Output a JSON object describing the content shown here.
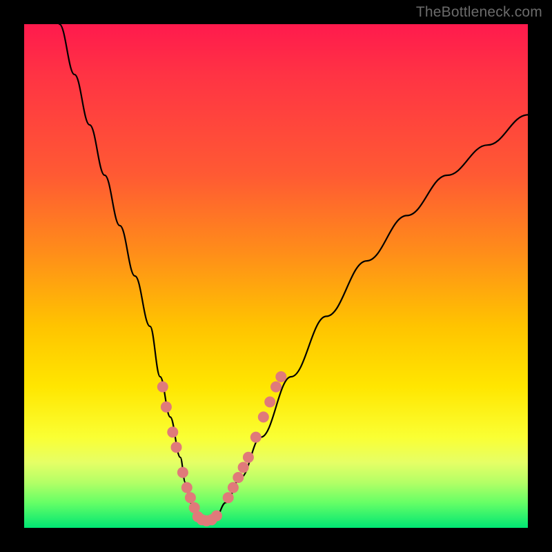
{
  "watermark": "TheBottleneck.com",
  "chart_data": {
    "type": "line",
    "title": "",
    "xlabel": "",
    "ylabel": "",
    "xlim": [
      0,
      100
    ],
    "ylim": [
      0,
      100
    ],
    "curve": {
      "note": "V-shaped bottleneck curve; left branch steep, right branch shallower. Points approximate reading from gradient background where 0=bottom(green) .. 100=top(red).",
      "x": [
        7,
        10,
        13,
        16,
        19,
        22,
        25,
        27,
        29,
        31,
        32,
        33,
        34,
        35,
        36,
        38,
        40,
        43,
        47,
        53,
        60,
        68,
        76,
        84,
        92,
        100
      ],
      "y": [
        100,
        90,
        80,
        70,
        60,
        50,
        40,
        30,
        22,
        14,
        9,
        5,
        3,
        1,
        1,
        2,
        5,
        10,
        18,
        30,
        42,
        53,
        62,
        70,
        76,
        82
      ]
    },
    "markers": {
      "note": "salmon-colored marker dots clustered near the valley on both branches",
      "left_branch": [
        {
          "x": 27.5,
          "y": 28
        },
        {
          "x": 28.2,
          "y": 24
        },
        {
          "x": 29.5,
          "y": 19
        },
        {
          "x": 30.2,
          "y": 16
        },
        {
          "x": 31.5,
          "y": 11
        },
        {
          "x": 32.3,
          "y": 8
        },
        {
          "x": 33.0,
          "y": 6
        },
        {
          "x": 33.8,
          "y": 4
        }
      ],
      "valley": [
        {
          "x": 34.5,
          "y": 2.2
        },
        {
          "x": 35.3,
          "y": 1.6
        },
        {
          "x": 36.2,
          "y": 1.4
        },
        {
          "x": 37.2,
          "y": 1.6
        },
        {
          "x": 38.2,
          "y": 2.4
        }
      ],
      "right_branch": [
        {
          "x": 40.5,
          "y": 6
        },
        {
          "x": 41.5,
          "y": 8
        },
        {
          "x": 42.5,
          "y": 10
        },
        {
          "x": 43.5,
          "y": 12
        },
        {
          "x": 44.5,
          "y": 14
        },
        {
          "x": 46.0,
          "y": 18
        },
        {
          "x": 47.5,
          "y": 22
        },
        {
          "x": 48.8,
          "y": 25
        },
        {
          "x": 50.0,
          "y": 28
        },
        {
          "x": 51.0,
          "y": 30
        }
      ]
    },
    "background_gradient_stops": [
      {
        "pct": 0,
        "color": "#ff1a4d"
      },
      {
        "pct": 30,
        "color": "#ff5a33"
      },
      {
        "pct": 60,
        "color": "#ffc400"
      },
      {
        "pct": 82,
        "color": "#faff33"
      },
      {
        "pct": 95,
        "color": "#66ff66"
      },
      {
        "pct": 100,
        "color": "#00e673"
      }
    ],
    "marker_style": {
      "color": "#e07a7a",
      "radius_px": 8
    }
  }
}
